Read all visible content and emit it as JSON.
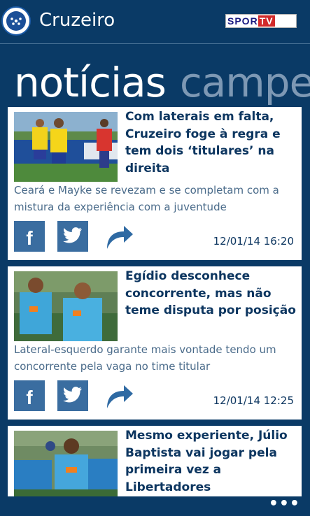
{
  "header": {
    "title": "Cruzeiro",
    "logo_icon": "cruzeiro-crest",
    "sponsor": {
      "part1": "SPOR",
      "part2": "TV"
    }
  },
  "pivot": {
    "active": "notícias",
    "next": "campe"
  },
  "articles": [
    {
      "headline": "Com laterais em falta, Cruzeiro foge à regra e tem dois ‘titulares’ na direita",
      "summary": "Ceará e Mayke se revezam e se completam com a mistura da experiência com a juventude",
      "timestamp": "12/01/14 16:20"
    },
    {
      "headline": "Egídio desconhece concorrente, mas não teme disputa por posição",
      "summary": "Lateral-esquerdo garante mais vontade tendo um concorrente pela vaga no time titular",
      "timestamp": "12/01/14 12:25"
    },
    {
      "headline": "Mesmo experiente, Júlio Baptista vai jogar pela primeira vez a Libertadores",
      "summary": "",
      "timestamp": ""
    }
  ],
  "share": {
    "facebook_label": "f",
    "icons": [
      "facebook-icon",
      "twitter-icon",
      "share-forward-icon"
    ]
  },
  "appbar": {
    "more_label": "•••"
  },
  "colors": {
    "background": "#0a3a66",
    "headline": "#0d3660",
    "summary": "#4a6b8a",
    "button": "#3a6da0"
  }
}
